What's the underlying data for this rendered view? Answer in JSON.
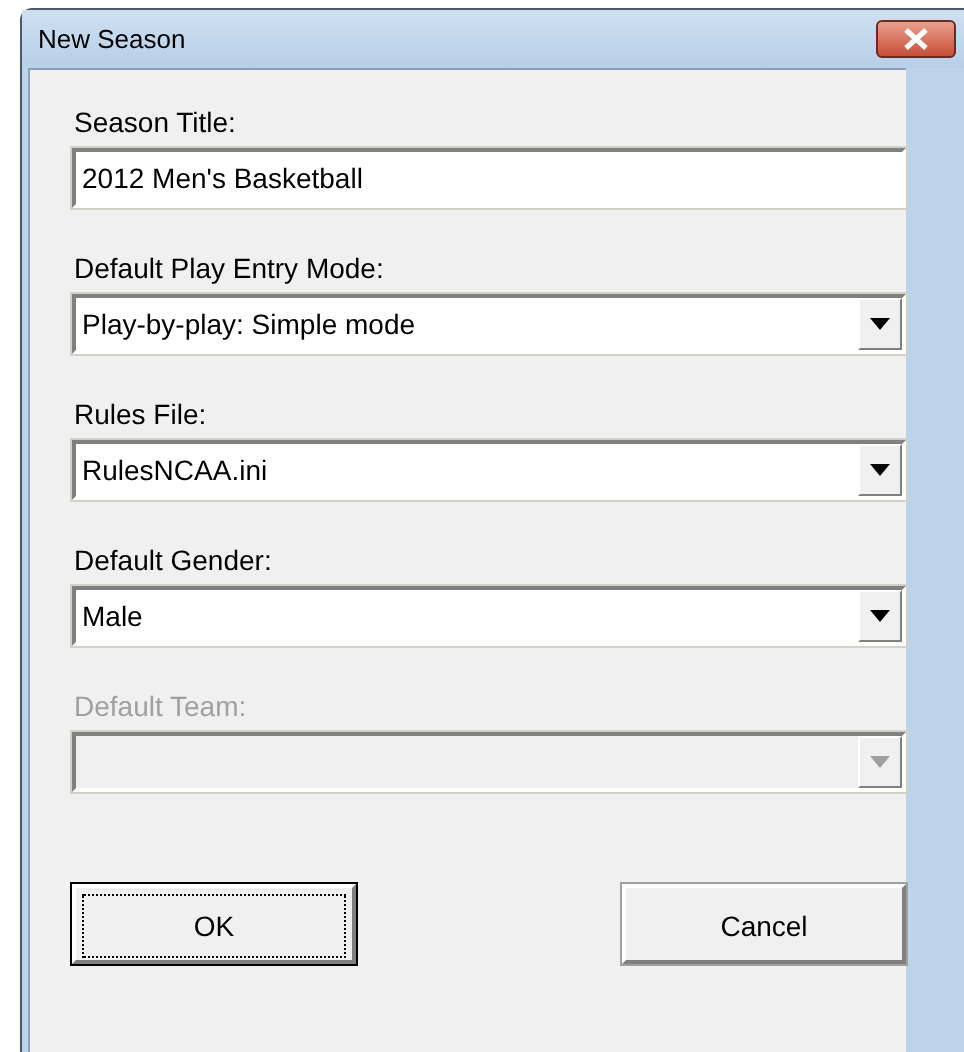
{
  "window": {
    "title": "New Season"
  },
  "fields": [
    {
      "kind": "text",
      "label": "Season Title:",
      "value": "2012 Men's Basketball",
      "disabled": false
    },
    {
      "kind": "dropdown",
      "label": "Default Play Entry Mode:",
      "value": "Play-by-play: Simple mode",
      "disabled": false
    },
    {
      "kind": "dropdown",
      "label": "Rules File:",
      "value": "RulesNCAA.ini",
      "disabled": false
    },
    {
      "kind": "dropdown",
      "label": "Default Gender:",
      "value": "Male",
      "disabled": false
    },
    {
      "kind": "dropdown",
      "label": "Default Team:",
      "disabled": true
    }
  ],
  "buttons": [
    {
      "label": "OK",
      "focused": true
    },
    {
      "label": "Cancel",
      "focused": false
    }
  ]
}
